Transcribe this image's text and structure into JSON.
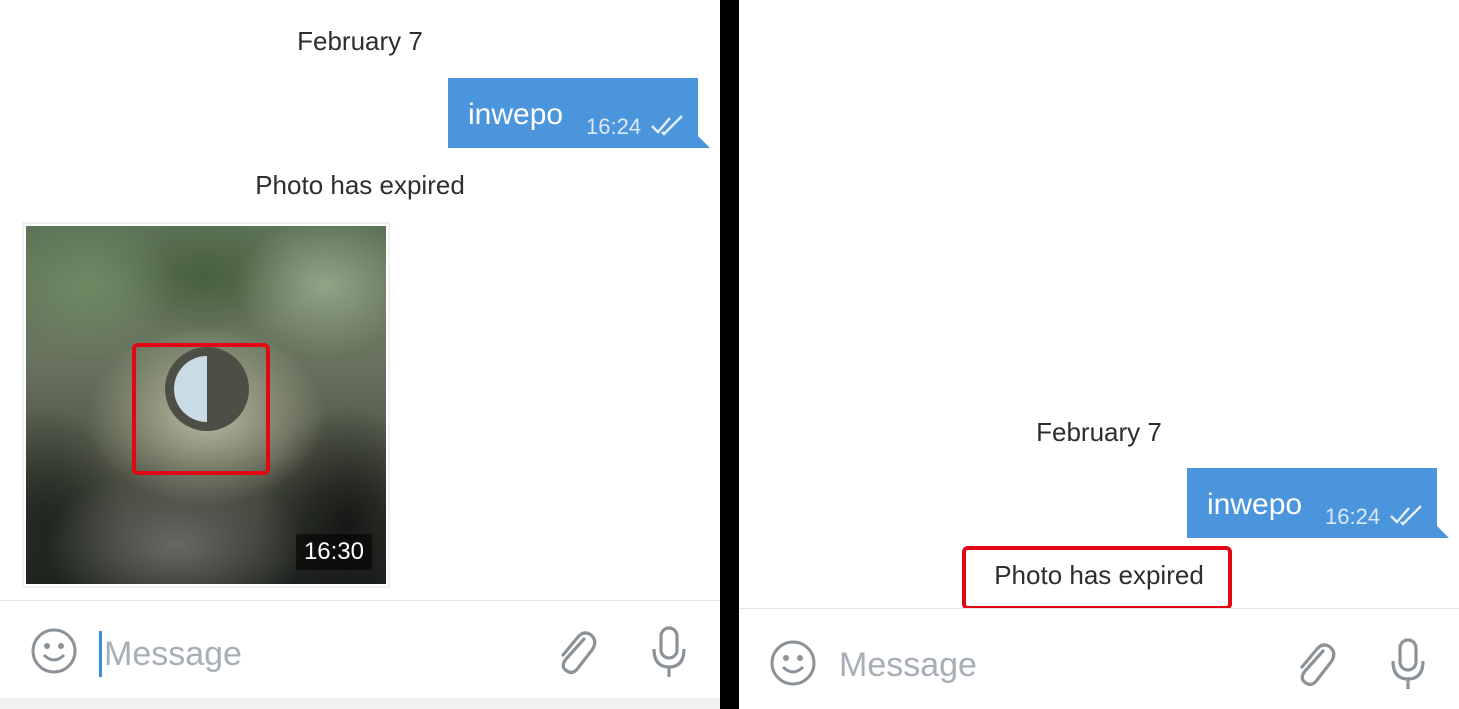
{
  "left": {
    "date_label": "February 7",
    "message": {
      "text": "inwepo",
      "time": "16:24",
      "status_icon": "double-check-icon"
    },
    "service_text": "Photo has expired",
    "photo": {
      "time": "16:30",
      "timer_icon": "self-destruct-timer-icon"
    },
    "input": {
      "placeholder": "Message"
    }
  },
  "right": {
    "date_label": "February 7",
    "message": {
      "text": "inwepo",
      "time": "16:24",
      "status_icon": "double-check-icon"
    },
    "service_text": "Photo has expired",
    "input": {
      "placeholder": "Message"
    }
  },
  "colors": {
    "bubble": "#4a95dc",
    "highlight": "#e30613",
    "divider": "#000000"
  }
}
